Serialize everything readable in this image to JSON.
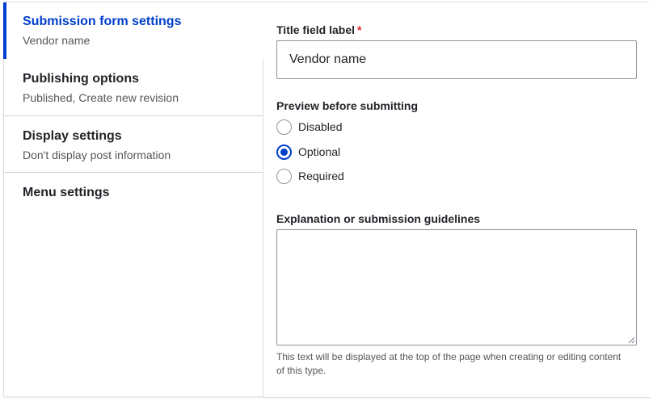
{
  "tabs": [
    {
      "title": "Submission form settings",
      "summary": "Vendor name"
    },
    {
      "title": "Publishing options",
      "summary": "Published, Create new revision"
    },
    {
      "title": "Display settings",
      "summary": "Don't display post information"
    },
    {
      "title": "Menu settings",
      "summary": ""
    }
  ],
  "form": {
    "title_field": {
      "label": "Title field label",
      "required_mark": "*",
      "value": "Vendor name"
    },
    "preview": {
      "label": "Preview before submitting",
      "options": [
        {
          "label": "Disabled",
          "checked": false
        },
        {
          "label": "Optional",
          "checked": true
        },
        {
          "label": "Required",
          "checked": false
        }
      ]
    },
    "guidelines": {
      "label": "Explanation or submission guidelines",
      "value": "",
      "description": "This text will be displayed at the top of the page when creating or editing content of this type."
    }
  },
  "colors": {
    "accent": "#003ecc",
    "required": "#dc2323",
    "border": "#8e929c"
  }
}
